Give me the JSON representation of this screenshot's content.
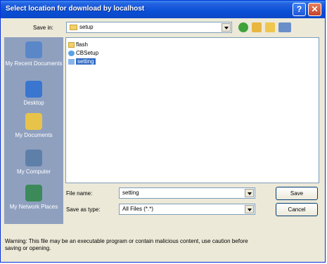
{
  "window": {
    "title": "Select location for download by localhost"
  },
  "titlebar": {
    "help": "?",
    "close": "✕"
  },
  "save_in": {
    "label": "Save in:",
    "value": "setup"
  },
  "places": [
    {
      "label": "My Recent Documents",
      "icon": "recent-documents-icon",
      "color": "#5a87c8"
    },
    {
      "label": "Desktop",
      "icon": "desktop-icon",
      "color": "#3a76d0"
    },
    {
      "label": "My Documents",
      "icon": "my-documents-icon",
      "color": "#e7c34a"
    },
    {
      "label": "My Computer",
      "icon": "my-computer-icon",
      "color": "#5e7fa8"
    },
    {
      "label": "My Network Places",
      "icon": "network-places-icon",
      "color": "#3c8a5a"
    }
  ],
  "files": [
    {
      "name": "flash",
      "type": "folder"
    },
    {
      "name": "CBSetup",
      "type": "program"
    },
    {
      "name": "setting",
      "type": "file",
      "selected": true
    }
  ],
  "file_name": {
    "label": "File name:",
    "value": "setting"
  },
  "save_as_type": {
    "label": "Save as type:",
    "value": "All Files (*.*)"
  },
  "buttons": {
    "save": "Save",
    "cancel": "Cancel"
  },
  "warning": "Warning: This file may be an executable program or contain malicious content, use caution before saving or opening.",
  "colors": {
    "title_bar": "#0a4fd6",
    "selection": "#316ac5",
    "places_bar": "#8fa0bf"
  }
}
